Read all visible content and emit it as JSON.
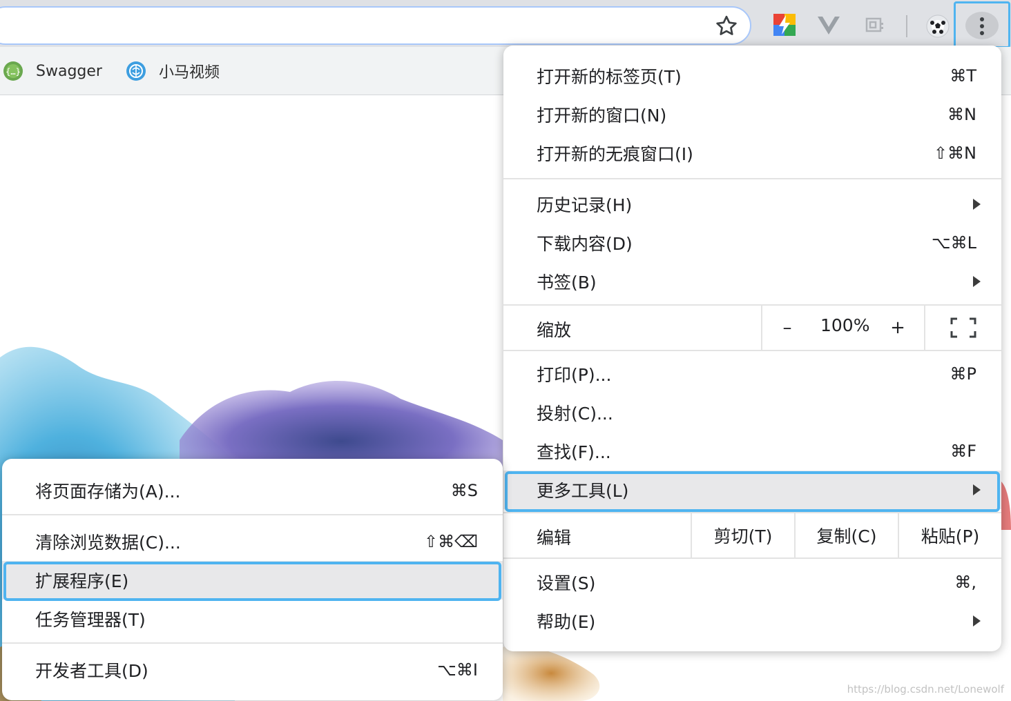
{
  "bookmarks": [
    {
      "label": "Swagger",
      "icon": "swagger-icon"
    },
    {
      "label": "小马视频",
      "icon": "brain-icon"
    }
  ],
  "main_menu": {
    "group1": [
      {
        "label": "打开新的标签页(T)",
        "shortcut": "⌘T"
      },
      {
        "label": "打开新的窗口(N)",
        "shortcut": "⌘N"
      },
      {
        "label": "打开新的无痕窗口(I)",
        "shortcut": "⇧⌘N"
      }
    ],
    "group2": [
      {
        "label": "历史记录(H)",
        "submenu": true
      },
      {
        "label": "下载内容(D)",
        "shortcut": "⌥⌘L"
      },
      {
        "label": "书签(B)",
        "submenu": true
      }
    ],
    "zoom": {
      "label": "缩放",
      "minus": "–",
      "value": "100%",
      "plus": "+"
    },
    "group3": [
      {
        "label": "打印(P)...",
        "shortcut": "⌘P"
      },
      {
        "label": "投射(C)..."
      },
      {
        "label": "查找(F)...",
        "shortcut": "⌘F"
      },
      {
        "label": "更多工具(L)",
        "submenu": true
      }
    ],
    "edit": {
      "label": "编辑",
      "cut": "剪切(T)",
      "copy": "复制(C)",
      "paste": "粘贴(P)"
    },
    "group4": [
      {
        "label": "设置(S)",
        "shortcut": "⌘,"
      },
      {
        "label": "帮助(E)",
        "submenu": true
      }
    ]
  },
  "sub_menu": {
    "items": [
      {
        "label": "将页面存储为(A)...",
        "shortcut": "⌘S"
      },
      {
        "label": "清除浏览数据(C)...",
        "shortcut": "⇧⌘⌫"
      },
      {
        "label": "扩展程序(E)"
      },
      {
        "label": "任务管理器(T)"
      },
      {
        "label": "开发者工具(D)",
        "shortcut": "⌥⌘I"
      }
    ]
  },
  "watermark": "https://blog.csdn.net/Lonewolf",
  "colors": {
    "highlight_border": "#4fb4f0",
    "toolbar": "#dfe1e5",
    "bookmarks_bar": "#f1f3f4"
  }
}
